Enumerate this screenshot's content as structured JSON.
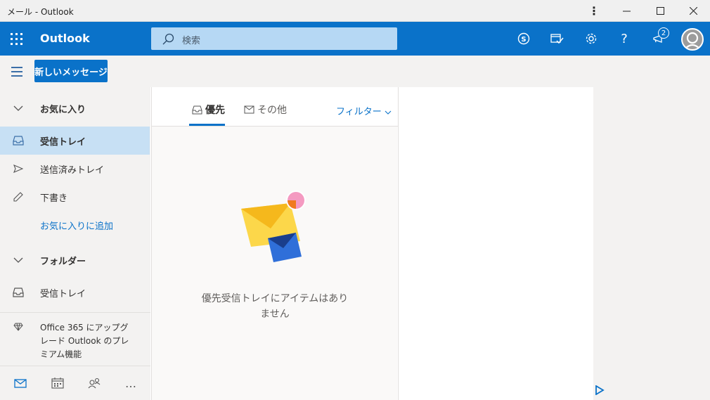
{
  "window": {
    "title": "メール - Outlook",
    "more_label": "⋮",
    "min_label": "—",
    "max_label": "☐",
    "close_label": "✕"
  },
  "header": {
    "brand": "Outlook",
    "search_placeholder": "検索",
    "notification_count": "2",
    "help_label": "?"
  },
  "commands": {
    "new_message": "新しいメッセージ"
  },
  "sidebar": {
    "favorites_header": "お気に入り",
    "favorites": [
      {
        "label": "受信トレイ",
        "icon": "inbox-icon",
        "selected": true
      },
      {
        "label": "送信済みトレイ",
        "icon": "sent-icon",
        "selected": false
      },
      {
        "label": "下書き",
        "icon": "pencil-icon",
        "selected": false
      }
    ],
    "add_favorite": "お気に入りに追加",
    "folders_header": "フォルダー",
    "folders": [
      {
        "label": "受信トレイ",
        "icon": "inbox-icon"
      }
    ],
    "upgrade_text": "Office 365 にアップグレード Outlook のプレミアム機能",
    "more_label": "…"
  },
  "message_list": {
    "tabs": [
      {
        "label": "優先",
        "active": true
      },
      {
        "label": "その他",
        "active": false
      }
    ],
    "filter_label": "フィルター",
    "empty_text": "優先受信トレイにアイテムはありません"
  },
  "colors": {
    "accent": "#0a72c9",
    "selected_bg": "#c7e0f4",
    "search_bg": "#b6d8f4"
  }
}
